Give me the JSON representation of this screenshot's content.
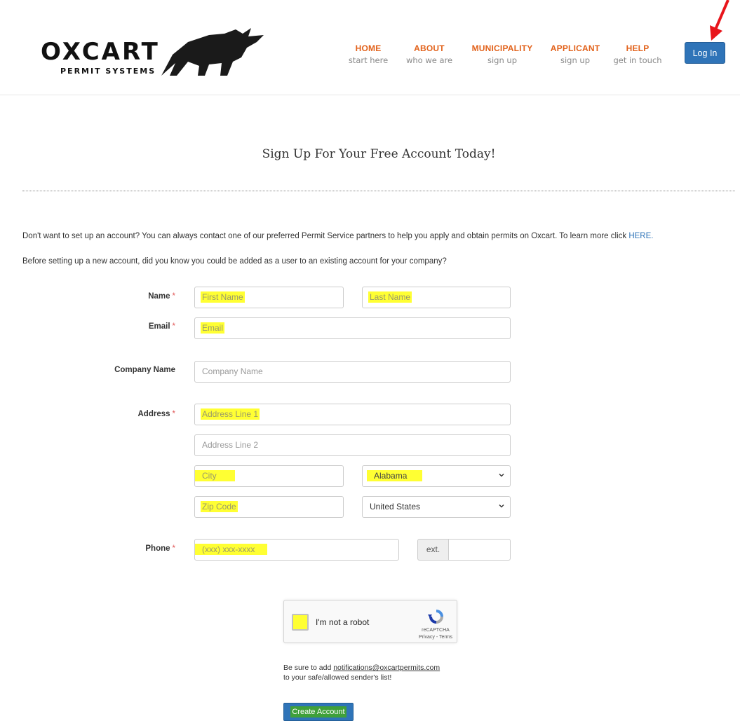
{
  "brand": {
    "name": "OXCART",
    "tagline": "PERMIT SYSTEMS"
  },
  "nav": [
    {
      "title": "HOME",
      "sub": "start here"
    },
    {
      "title": "ABOUT",
      "sub": "who we are"
    },
    {
      "title": "MUNICIPALITY",
      "sub": "sign up"
    },
    {
      "title": "APPLICANT",
      "sub": "sign up"
    },
    {
      "title": "HELP",
      "sub": "get in touch"
    }
  ],
  "login_label": "Log In",
  "page_title": "Sign Up For Your Free Account Today!",
  "info": {
    "line1": "Don't want to set up an account? You can always contact one of our preferred Permit Service partners to help you apply and obtain permits on Oxcart. To learn more click",
    "line1_link": "HERE.",
    "line2": "Before setting up a new account, did you know you could be added as a user to an existing account for your company?"
  },
  "form": {
    "required_mark": "*",
    "name_label": "Name",
    "first_name_placeholder": "First Name",
    "last_name_placeholder": "Last Name",
    "email_label": "Email",
    "email_placeholder": "Email",
    "company_label": "Company Name",
    "company_placeholder": "Company Name",
    "address_label": "Address",
    "address1_placeholder": "Address Line 1",
    "address2_placeholder": "Address Line 2",
    "city_placeholder": "City",
    "state_value": "Alabama",
    "zip_placeholder": "Zip Code",
    "country_value": "United States",
    "phone_label": "Phone",
    "phone_placeholder": "(xxx) xxx-xxxx",
    "ext_label": "ext."
  },
  "captcha": {
    "label": "I'm not a robot",
    "brand": "reCAPTCHA",
    "links": "Privacy - Terms"
  },
  "note": {
    "prefix": "Be sure to add",
    "email": "notifications@oxcartpermits.com",
    "suffix": "to your safe/allowed sender's list!"
  },
  "create_label": "Create Account",
  "colors": {
    "accent": "#e2621b",
    "button": "#2f74b8",
    "highlight": "#ffff33",
    "arrow": "#e8151b"
  }
}
